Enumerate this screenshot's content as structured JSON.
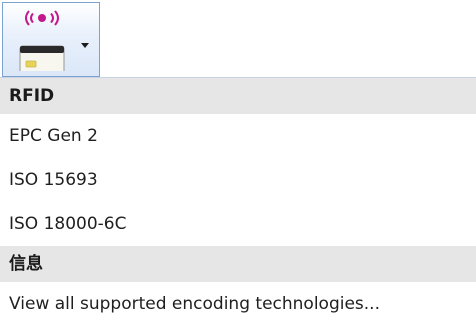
{
  "toolbar": {
    "button_icon": "rfid-card-icon",
    "dropdown_icon": "chevron-down-icon",
    "colors": {
      "border": "#7da2ce",
      "signal": "#c2188b",
      "card": "#2a2a2a",
      "chip": "#e8d35a"
    }
  },
  "menu": {
    "sections": [
      {
        "header": "RFID",
        "items": [
          "EPC Gen 2",
          "ISO 15693",
          "ISO 18000-6C"
        ]
      },
      {
        "header": "信息",
        "items": [
          "View all supported encoding technologies..."
        ]
      }
    ]
  }
}
